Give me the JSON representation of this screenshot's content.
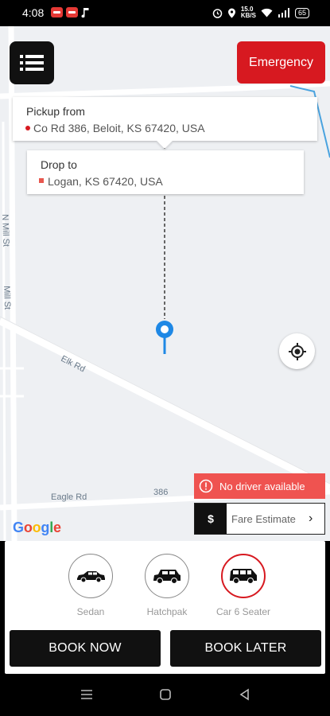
{
  "status_bar": {
    "time": "4:08",
    "speed_top": "15.0",
    "speed_bottom": "KB/S",
    "battery": "65"
  },
  "header": {
    "menu_icon": "list-menu-icon",
    "emergency_label": "Emergency"
  },
  "pickup": {
    "label": "Pickup from",
    "address": "Co Rd 386, Beloit, KS 67420, USA"
  },
  "drop": {
    "label": "Drop to",
    "address": "Logan, KS 67420, USA"
  },
  "map": {
    "street_labels": [
      "N Mill St",
      "Mill St",
      "Elk Rd",
      "Eagle Rd",
      "386"
    ],
    "attribution": "Google",
    "route_color": "#1e88e5",
    "accent_color": "#d71920"
  },
  "alert": {
    "no_driver": "No driver available"
  },
  "fare": {
    "currency": "$",
    "label": "Fare Estimate",
    "chevron": "›"
  },
  "vehicles": [
    {
      "label": "Sedan",
      "icon": "sedan-car-icon",
      "selected": false
    },
    {
      "label": "Hatchpak",
      "icon": "hatchback-car-icon",
      "selected": false
    },
    {
      "label": "Car 6 Seater",
      "icon": "suv-car-icon",
      "selected": true
    }
  ],
  "actions": {
    "book_now": "BOOK NOW",
    "book_later": "BOOK LATER"
  }
}
